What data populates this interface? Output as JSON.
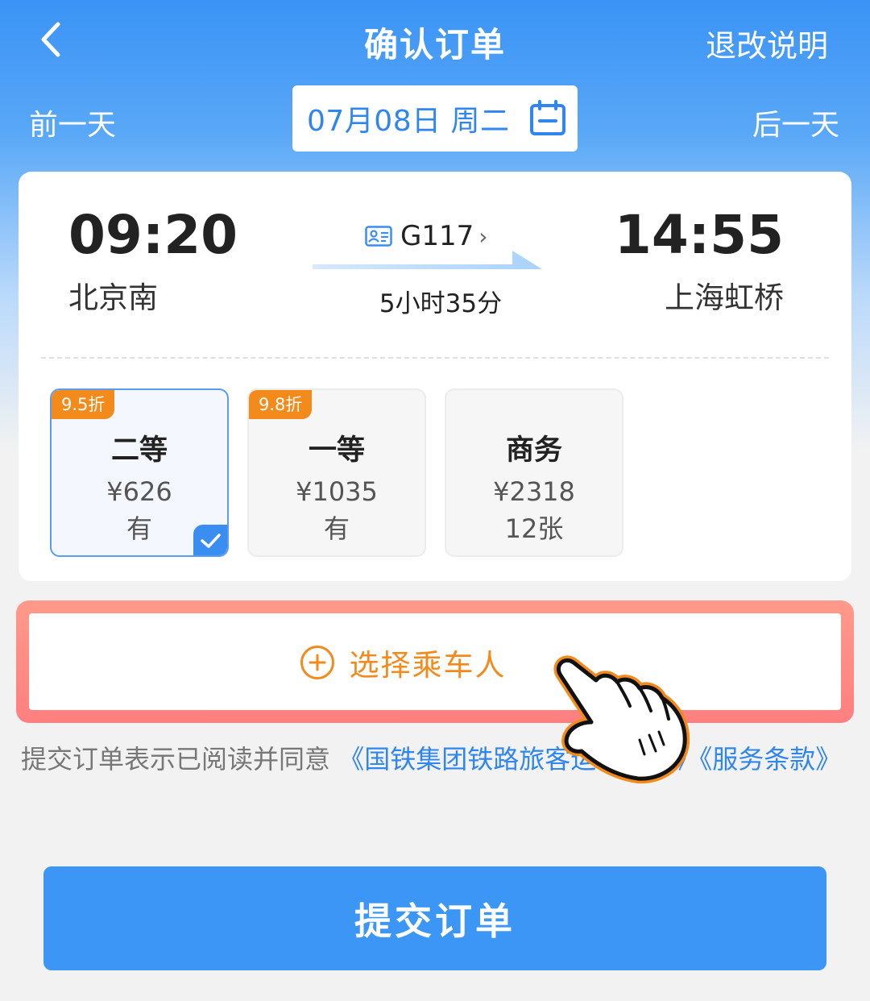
{
  "header": {
    "title": "确认订单",
    "right_link": "退改说明"
  },
  "datebar": {
    "prev": "前一天",
    "date": "07月08日 周二",
    "next": "后一天"
  },
  "train": {
    "depart_time": "09:20",
    "depart_station": "北京南",
    "train_no": "G117",
    "duration": "5小时35分",
    "arrive_time": "14:55",
    "arrive_station": "上海虹桥"
  },
  "seats": [
    {
      "discount": "9.5折",
      "name": "二等",
      "price": "¥626",
      "availability": "有",
      "selected": true
    },
    {
      "discount": "9.8折",
      "name": "一等",
      "price": "¥1035",
      "availability": "有",
      "selected": false
    },
    {
      "discount": "",
      "name": "商务",
      "price": "¥2318",
      "availability": "12张",
      "selected": false
    }
  ],
  "passenger": {
    "button_label": "选择乘车人"
  },
  "terms": {
    "prefix": "提交订单表示已阅读并同意",
    "link1": "《国铁集团铁路旅客运输规程》",
    "link2": "《服务条款》"
  },
  "submit_label": "提交订单",
  "colors": {
    "primary": "#3c96f5",
    "accent_orange": "#f28a1c",
    "highlight_frame": "#ff7f7f"
  }
}
